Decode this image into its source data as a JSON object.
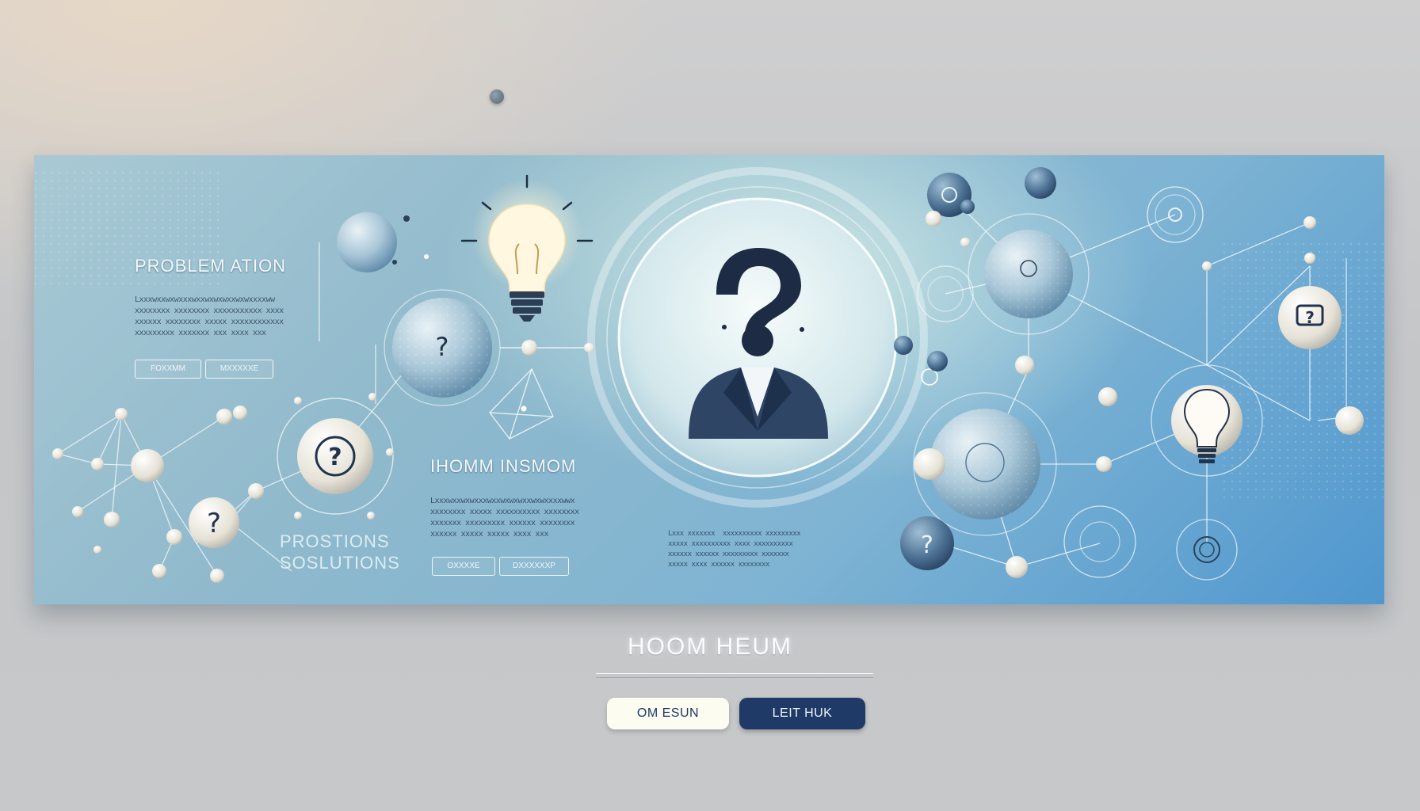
{
  "panel": {
    "section_problem": {
      "heading": "PROBLEM  ATION",
      "text_lines": [
        "Lxxxwxxwxwxxxwxxwxwxwxxwxwxxxxww",
        "xxxxxxxx xxxxxxxx xxxxxxxxxxx xxxx",
        "xxxxxx xxxxxxxx xxxxx xxxxxxxxxxxx",
        "xxxxxxxxx xxxxxxx xxx xxxx xxx"
      ],
      "button_1": "FOXXMM",
      "button_2": "MXXXXXE"
    },
    "section_insight": {
      "heading": "IHOMM INSMOM",
      "text_lines": [
        "Lxxxwxxwxwxxxwxxwxwxwxxwxwxxxxwwx",
        "xxxxxxxx xxxxx xxxxxxxxxx xxxxxxxx",
        "xxxxxxx xxxxxxxxx xxxxxx xxxxxxxx",
        "xxxxxx xxxxx xxxxx xxxx xxx"
      ],
      "button_1": "OXXXXE",
      "button_2": "DXXXXXXP"
    },
    "section_solutions": {
      "heading_line_1": "PROSTIONS",
      "heading_line_2": "SOSLUTIONS"
    },
    "section_center_text": {
      "text_lines": [
        "Lxxx xxxxxxx  xxxxxxxxxx xxxxxxxxx",
        "xxxxx xxxxxxxxxx xxxx xxxxxxxxxx",
        "xxxxxx xxxxxx xxxxxxxxx xxxxxxx",
        "xxxxx xxxx xxxxxx xxxxxxxx"
      ]
    }
  },
  "footer": {
    "title": "HOOM HEUM",
    "primary_button": "OM ESUN",
    "secondary_button": "LEIT HUK"
  },
  "colors": {
    "navy": "#1f3a66",
    "cream": "#fdfcf1",
    "panel_accent": "#4f97cf"
  },
  "icons": [
    "question-mark-icon",
    "lightbulb-icon",
    "person-silhouette-icon",
    "network-node-icon"
  ]
}
